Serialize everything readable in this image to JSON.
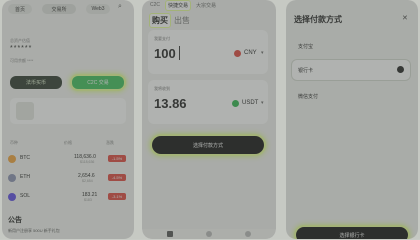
{
  "p1": {
    "seg": [
      "首页",
      "交易所",
      "Web3"
    ],
    "total_label": "总资产估值",
    "total_value": "******",
    "subtitle": "可用余额 ****",
    "btn_buy": "法币买币",
    "btn_c2c": "C2C 交易",
    "list_header": [
      "币种",
      "价格",
      "涨跌"
    ],
    "coins": [
      {
        "name": "BTC",
        "price": "118,636.0",
        "sub": "$118,636",
        "change": "-1.5%",
        "color": "#f2a33a"
      },
      {
        "name": "ETH",
        "price": "2,654.6",
        "sub": "$2,654",
        "change": "-4.5%",
        "color": "#8a92b2"
      },
      {
        "name": "SOL",
        "price": "183.21",
        "sub": "$183",
        "change": "-3.1%",
        "color": "#5b4ae6"
      }
    ],
    "notice_title": "公告",
    "notice_text": "新用户注册享 500U 新手礼包"
  },
  "p2": {
    "tabs": [
      "C2C",
      "快捷交易",
      "大宗交易"
    ],
    "mode_buy": "购买",
    "mode_sell": "出售",
    "pay_label": "我要支付",
    "pay_value": "100",
    "pay_currency": "CNY",
    "get_label": "我将收到",
    "get_value": "13.86",
    "get_currency": "USDT",
    "cta": "选择付款方式"
  },
  "p3": {
    "title": "选择付款方式",
    "options": [
      "支付宝",
      "银行卡",
      "微信支付"
    ],
    "selected_index": 1,
    "confirm": "选择银行卡"
  },
  "colors": {
    "green": "#2fb64d",
    "red": "#e0453c",
    "glow": "#d9ff6a"
  }
}
